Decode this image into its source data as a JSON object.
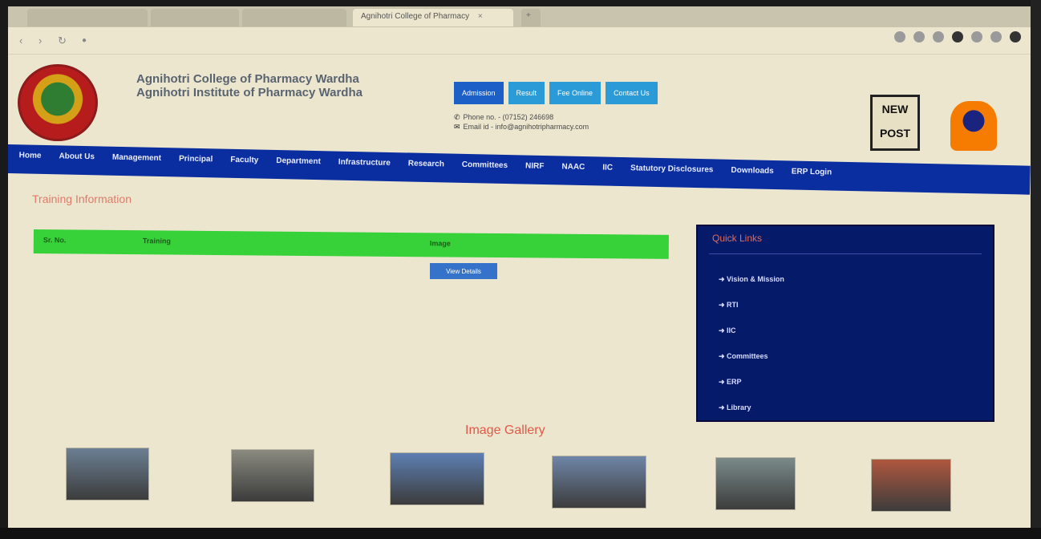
{
  "browser": {
    "tabs": [
      {
        "label": "",
        "active": false
      },
      {
        "label": "",
        "active": false
      },
      {
        "label": "",
        "active": false
      },
      {
        "label": "Agnihotri College of Pharmacy",
        "active": true
      }
    ],
    "nav_back": "‹",
    "nav_forward": "›",
    "nav_reload": "↻",
    "url": ""
  },
  "header": {
    "college_name_1": "Agnihotri College of Pharmacy Wardha",
    "college_name_2": "Agnihotri Institute of Pharmacy Wardha",
    "buttons": [
      "Admission",
      "Result",
      "Fee Online",
      "Contact Us"
    ],
    "phone": "Phone no. - (07152) 246698",
    "email": "Email id - info@agnihotripharmacy.com"
  },
  "badge": {
    "line1": "NEW",
    "line2": "POST"
  },
  "nav": {
    "items": [
      "Home",
      "About Us",
      "Management",
      "Principal",
      "Faculty",
      "Department",
      "Infrastructure",
      "Research",
      "Committees",
      "NIRF",
      "NAAC",
      "IIC",
      "Statutory Disclosures",
      "Downloads",
      "ERP Login"
    ]
  },
  "content": {
    "section_title": "Training Information",
    "subline": "",
    "table_headers": {
      "col1": "Sr. No.",
      "col2": "Training",
      "col3": "Image"
    },
    "row_text": "",
    "view_button": "View Details"
  },
  "quick_links": {
    "title": "Quick Links",
    "items": [
      "➜ Vision & Mission",
      "➜ RTI",
      "➜ IIC",
      "➜ Committees",
      "➜ ERP",
      "➜ Library"
    ]
  },
  "gallery": {
    "title": "Image Gallery",
    "thumbs": [
      {
        "name": "gallery-photo-1",
        "color": "#6b7f93"
      },
      {
        "name": "gallery-photo-2",
        "color": "#8a8a80"
      },
      {
        "name": "gallery-photo-3",
        "color": "#5d7fb2"
      },
      {
        "name": "gallery-photo-4",
        "color": "#6f86a8"
      },
      {
        "name": "gallery-photo-5",
        "color": "#7a8a8a"
      },
      {
        "name": "gallery-photo-6",
        "color": "#b0573e"
      }
    ]
  },
  "colors": {
    "nav_bg": "#0a2da0",
    "table_header_bg": "#37d13a",
    "quick_links_bg": "#061a6a",
    "accent_red": "#e05a4a",
    "button_blue": "#2a9bd6"
  }
}
